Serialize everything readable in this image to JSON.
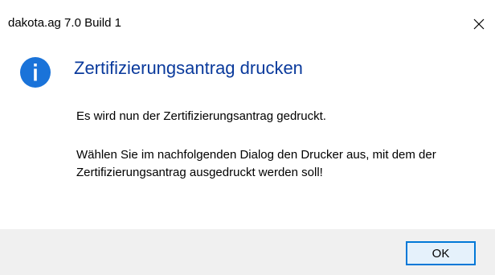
{
  "window": {
    "title": "dakota.ag 7.0 Build 1",
    "close_icon": "close-icon"
  },
  "content": {
    "icon": "info-icon",
    "icon_color": "#1a73d9",
    "heading": "Zertifizierungsantrag drucken",
    "heading_color": "#0a3a9c",
    "message_line1": "Es wird nun der Zertifizierungsantrag gedruckt.",
    "message_line2": "Wählen Sie im nachfolgenden Dialog den Drucker aus, mit dem der Zertifizierungsantrag ausgedruckt werden soll!"
  },
  "footer": {
    "ok_label": "OK",
    "accent": "#0078d7"
  }
}
